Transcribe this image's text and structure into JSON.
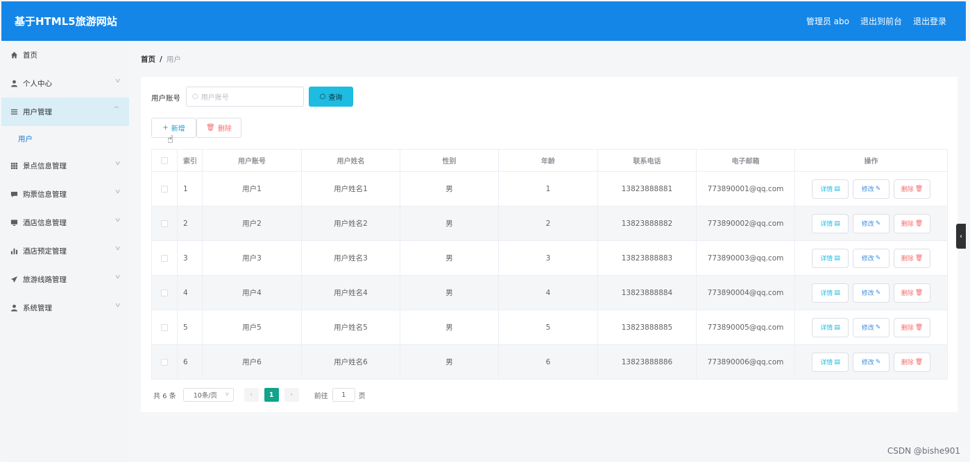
{
  "header": {
    "brand": "基于HTML5旅游网站",
    "links": [
      "管理员 abo",
      "退出到前台",
      "退出登录"
    ]
  },
  "sidebar": {
    "items": [
      {
        "label": "首页",
        "icon": "home-icon"
      },
      {
        "label": "个人中心",
        "icon": "user-icon"
      },
      {
        "label": "用户管理",
        "icon": "list-icon"
      },
      {
        "label": "景点信息管理",
        "icon": "grid-icon"
      },
      {
        "label": "购票信息管理",
        "icon": "chat-icon"
      },
      {
        "label": "酒店信息管理",
        "icon": "monitor-icon"
      },
      {
        "label": "酒店预定管理",
        "icon": "bar-chart-icon"
      },
      {
        "label": "旅游线路管理",
        "icon": "send-icon"
      },
      {
        "label": "系统管理",
        "icon": "user-icon"
      }
    ],
    "active_submenu": "用户"
  },
  "breadcrumb": {
    "home": "首页",
    "sep": "/",
    "current": "用户"
  },
  "search": {
    "label": "用户账号",
    "placeholder": "用户账号",
    "button": "查询"
  },
  "actions": {
    "add": "新增",
    "delete": "删除"
  },
  "table": {
    "columns": [
      "索引",
      "用户账号",
      "用户姓名",
      "性别",
      "年龄",
      "联系电话",
      "电子邮箱",
      "操作"
    ],
    "rows": [
      {
        "idx": "1",
        "account": "用户1",
        "name": "用户姓名1",
        "sex": "男",
        "age": "1",
        "phone": "13823888881",
        "email": "773890001@qq.com"
      },
      {
        "idx": "2",
        "account": "用户2",
        "name": "用户姓名2",
        "sex": "男",
        "age": "2",
        "phone": "13823888882",
        "email": "773890002@qq.com"
      },
      {
        "idx": "3",
        "account": "用户3",
        "name": "用户姓名3",
        "sex": "男",
        "age": "3",
        "phone": "13823888883",
        "email": "773890003@qq.com"
      },
      {
        "idx": "4",
        "account": "用户4",
        "name": "用户姓名4",
        "sex": "男",
        "age": "4",
        "phone": "13823888884",
        "email": "773890004@qq.com"
      },
      {
        "idx": "5",
        "account": "用户5",
        "name": "用户姓名5",
        "sex": "男",
        "age": "5",
        "phone": "13823888885",
        "email": "773890005@qq.com"
      },
      {
        "idx": "6",
        "account": "用户6",
        "name": "用户姓名6",
        "sex": "男",
        "age": "6",
        "phone": "13823888886",
        "email": "773890006@qq.com"
      }
    ],
    "ops": {
      "detail": "详情",
      "edit": "修改",
      "delete": "删除"
    }
  },
  "pagination": {
    "total": "共 6 条",
    "page_size": "10条/页",
    "current_page": "1",
    "goto_label": "前往",
    "goto_value": "1",
    "page_suffix": "页"
  },
  "watermark": "CSDN @bishe901",
  "colors": {
    "header": "#1486e8",
    "primary": "#1dbce0",
    "page_active": "#11a48a",
    "danger": "#f56c6c"
  }
}
